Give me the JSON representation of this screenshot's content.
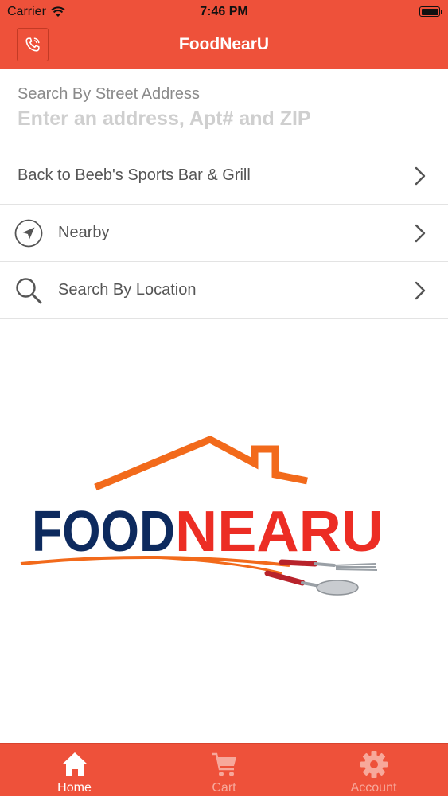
{
  "status_bar": {
    "carrier": "Carrier",
    "time": "7:46 PM"
  },
  "nav": {
    "title": "FoodNearU",
    "call_icon": "phone-icon"
  },
  "search": {
    "label": "Search By Street Address",
    "placeholder": "Enter an address, Apt# and ZIP",
    "value": ""
  },
  "rows": [
    {
      "label": "Back to Beeb's Sports Bar & Grill",
      "icon": ""
    },
    {
      "label": "Nearby",
      "icon": "location-arrow-icon"
    },
    {
      "label": "Search By Location",
      "icon": "search-icon"
    }
  ],
  "logo": {
    "part1": "FOOD",
    "part2": "NEARU"
  },
  "tabs": [
    {
      "label": "Home",
      "icon": "home-icon",
      "active": true
    },
    {
      "label": "Cart",
      "icon": "cart-icon",
      "active": false
    },
    {
      "label": "Account",
      "icon": "gear-icon",
      "active": false
    }
  ],
  "colors": {
    "brand": "#ee513a",
    "logo_blue": "#0d2a5e",
    "logo_red": "#ec2d24",
    "logo_orange": "#f26a1b"
  }
}
